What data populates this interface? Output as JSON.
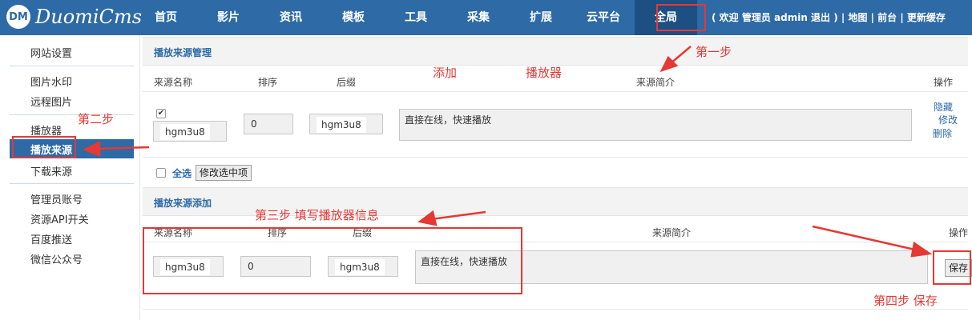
{
  "app": {
    "logo_badge": "DM",
    "logo_text": "DuomiCms"
  },
  "nav": {
    "items": [
      "首页",
      "影片",
      "资讯",
      "模板",
      "工具",
      "采集",
      "扩展",
      "云平台",
      "全局"
    ],
    "active": "全局"
  },
  "user_bar": "( 欢迎 管理员 admin 退出 ) | 地图 | 前台 | 更新缓存",
  "sidebar": {
    "items": [
      "网站设置",
      "图片水印",
      "远程图片",
      "播放器",
      "播放来源",
      "下载来源",
      "管理员账号",
      "资源API开关",
      "百度推送",
      "微信公众号"
    ],
    "active": "播放来源"
  },
  "manage": {
    "title": "播放来源管理",
    "columns": [
      "来源名称",
      "排序",
      "后缀",
      "来源简介",
      "操作"
    ],
    "row": {
      "name": "hgm3u8",
      "order": "0",
      "suffix": "hgm3u8",
      "intro": "直接在线，快速播放",
      "actions": [
        "隐藏",
        "修改",
        "删除"
      ],
      "checked": "✔"
    },
    "select_all": "全选",
    "modify_selected": "修改选中项"
  },
  "add": {
    "title": "播放来源添加",
    "columns": [
      "来源名称",
      "排序",
      "后缀",
      "来源简介",
      "操作"
    ],
    "row": {
      "name": "hgm3u8",
      "order": "0",
      "suffix": "hgm3u8",
      "intro": "直接在线，快速播放"
    },
    "save": "保存"
  },
  "annotations": {
    "step1": "第一步",
    "step2": "第二步",
    "step3": "第三步  填写播放器信息",
    "step4": "第四步  保存",
    "add_player_a": "添加",
    "add_player_b": "播放器"
  },
  "colors": {
    "brand": "#2d6aa6",
    "annotation": "#e53935"
  }
}
